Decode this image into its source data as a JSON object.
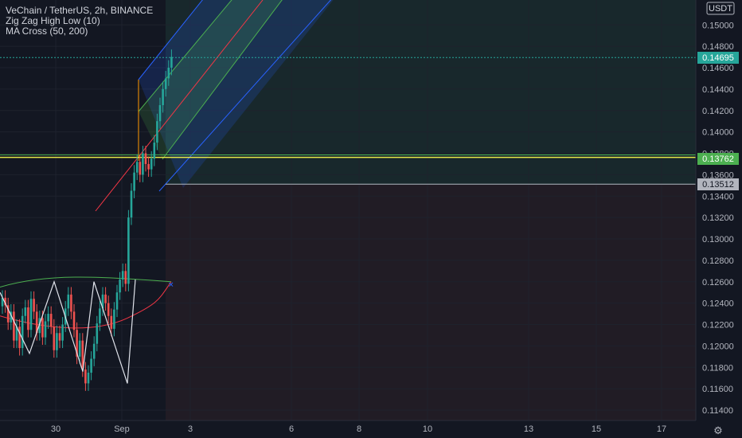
{
  "legend": {
    "symbol_line": "VeChain / TetherUS, 2h, BINANCE",
    "indicator_1": "Zig Zag High Low (10)",
    "indicator_2": "MA Cross (50, 200)"
  },
  "axis": {
    "currency": "USDT",
    "price_ticks": [
      "0.15000",
      "0.14800",
      "0.14600",
      "0.14400",
      "0.14200",
      "0.14000",
      "0.13800",
      "0.13600",
      "0.13400",
      "0.13200",
      "0.13000",
      "0.12800",
      "0.12600",
      "0.12400",
      "0.12200",
      "0.12000",
      "0.11800",
      "0.11600",
      "0.11400"
    ],
    "time_ticks": [
      "30",
      "Sep",
      "3",
      "6",
      "8",
      "10",
      "13",
      "15",
      "17"
    ]
  },
  "badges": {
    "last_price": "0.14695",
    "line_price": "0.13762",
    "stop_price": "0.13512"
  },
  "colors": {
    "background": "#131722",
    "up": "#26a69a",
    "down": "#ef5350",
    "last_price_badge": "#26a69a",
    "yellow_line": "#e8e84a",
    "green_line": "#4caf50",
    "channel_blue": "#2962ff",
    "channel_green": "#4caf50",
    "channel_red": "#f23645",
    "ma_fast": "#4caf50",
    "ma_slow": "#f23645"
  },
  "chart_data": {
    "type": "candlestick",
    "symbol": "VeChain / TetherUS",
    "interval": "2h",
    "exchange": "BINANCE",
    "ylim": [
      0.1135,
      0.152
    ],
    "candles_close_path": [
      0.1245,
      0.1238,
      0.1222,
      0.1232,
      0.1205,
      0.1218,
      0.1198,
      0.1228,
      0.1236,
      0.1215,
      0.1244,
      0.1232,
      0.1212,
      0.1226,
      0.1208,
      0.1223,
      0.123,
      0.1218,
      0.1196,
      0.1212,
      0.1205,
      0.122,
      0.1235,
      0.1248,
      0.1232,
      0.1215,
      0.119,
      0.1205,
      0.1178,
      0.1165,
      0.1175,
      0.1188,
      0.1202,
      0.1221,
      0.1235,
      0.1248,
      0.124,
      0.1228,
      0.1216,
      0.1234,
      0.125,
      0.1262,
      0.127,
      0.1258,
      0.132,
      0.1345,
      0.1362,
      0.1372,
      0.136,
      0.138,
      0.137,
      0.1365,
      0.1375,
      0.139,
      0.141,
      0.1425,
      0.144,
      0.145,
      0.146,
      0.147
    ],
    "horizontal_lines": [
      {
        "name": "last price",
        "value": 0.14695
      },
      {
        "name": "yellow level",
        "value": 0.13762
      },
      {
        "name": "green level",
        "value": 0.13785
      },
      {
        "name": "stop level",
        "value": 0.13512
      }
    ],
    "zigzag_points": [
      0.125,
      0.1193,
      0.126,
      0.1176,
      0.126,
      0.1165,
      0.1262
    ],
    "ma_cross_label": "MA Cross (50, 200)"
  }
}
